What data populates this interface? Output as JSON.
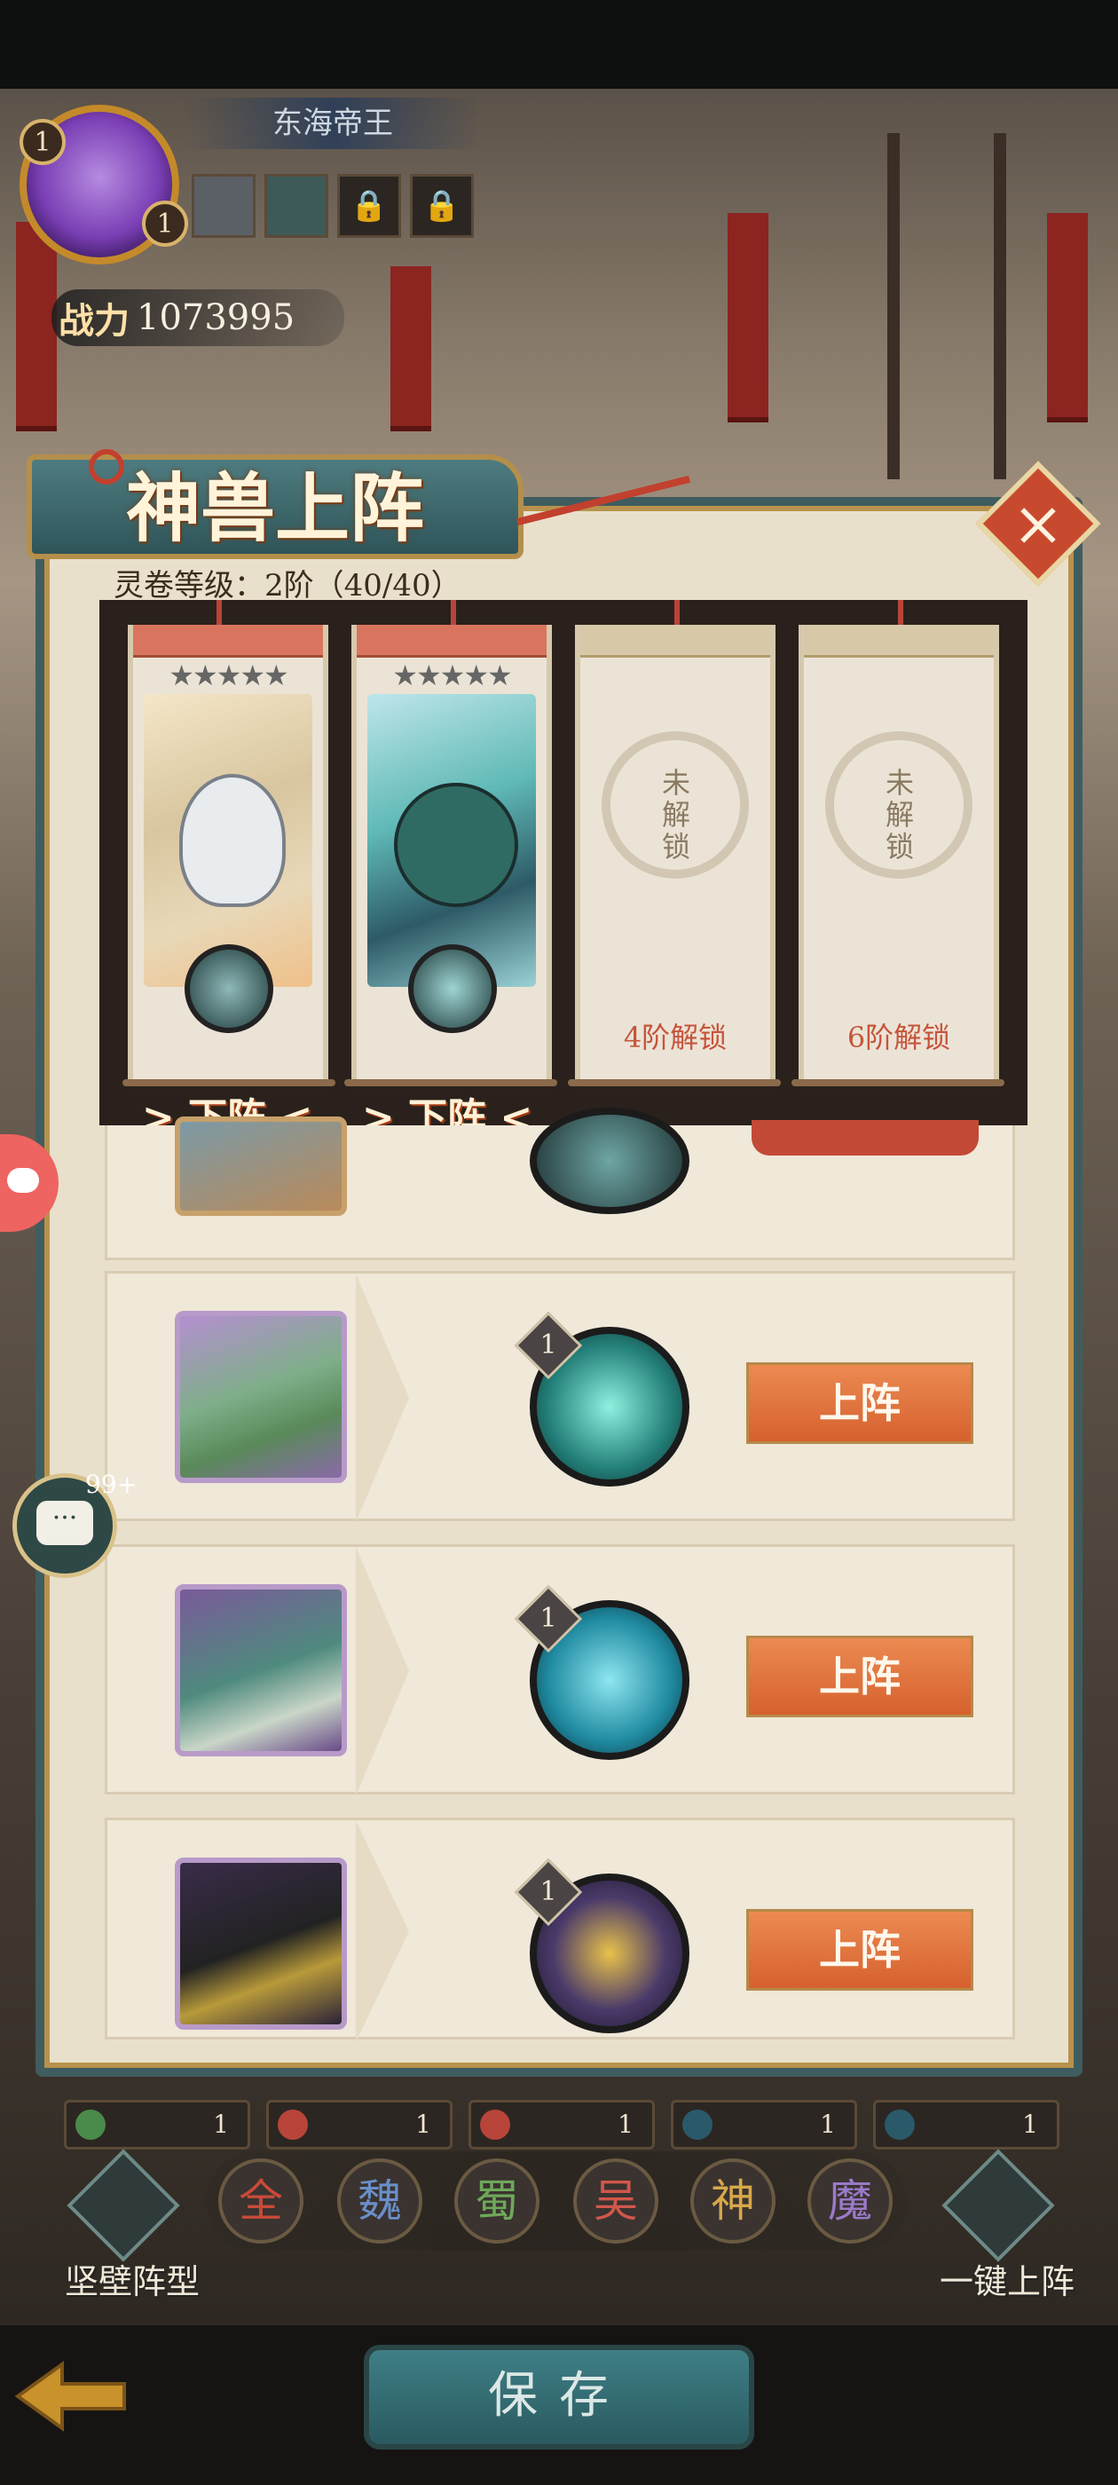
{
  "header": {
    "player_name": "东海帝王",
    "level_a": "1",
    "level_b": "1",
    "power_label": "战力",
    "power_value": "1073995"
  },
  "panel": {
    "title": "神兽上阵",
    "close_icon": "close-x-icon",
    "tier_text": "灵卷等级：2阶（40/40）"
  },
  "slots": [
    {
      "state": "equipped",
      "stars": "★★★★★",
      "beast": "white-tiger",
      "action": "> 下阵 <"
    },
    {
      "state": "equipped",
      "stars": "★★★★★",
      "beast": "azure-qilin",
      "action": "> 下阵 <"
    },
    {
      "state": "locked",
      "seal_text": "未解锁",
      "unlock_condition": "4阶解锁"
    },
    {
      "state": "locked",
      "seal_text": "未解锁",
      "unlock_condition": "6阶解锁"
    }
  ],
  "beast_list": [
    {
      "name": "partial-beast",
      "skill_level": "",
      "button": ""
    },
    {
      "name": "green-dragon",
      "skill_level": "1",
      "button": "上阵",
      "stars": "★★★★★"
    },
    {
      "name": "jade-deer",
      "skill_level": "1",
      "button": "上阵",
      "stars": "★★★★★"
    },
    {
      "name": "shadow-wolf",
      "skill_level": "1",
      "button": "上阵",
      "stars": "★★★★★"
    }
  ],
  "side": {
    "chat_badge": "99+",
    "chat_icon": "···"
  },
  "category_tabs": [
    "1",
    "1",
    "1",
    "1",
    "1"
  ],
  "factions": [
    {
      "label": "全",
      "color": "#c94a3a"
    },
    {
      "label": "魏",
      "color": "#6a8fc9"
    },
    {
      "label": "蜀",
      "color": "#6ea85a"
    },
    {
      "label": "吴",
      "color": "#d1574a"
    },
    {
      "label": "神",
      "color": "#d7a84a"
    },
    {
      "label": "魔",
      "color": "#9b7ac9"
    }
  ],
  "bottom": {
    "formation_label": "坚壁阵型",
    "one_key_label": "一键上阵",
    "save_label": "保存"
  }
}
